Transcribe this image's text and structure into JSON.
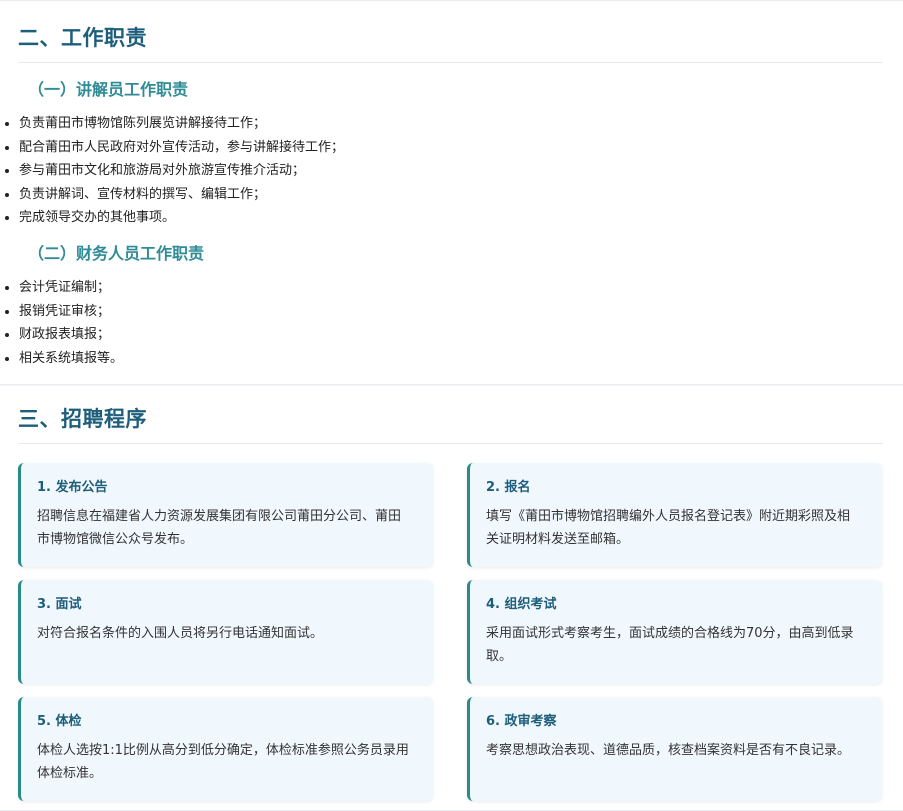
{
  "duties": {
    "title": "二、工作职责",
    "guide": {
      "title": "（一）讲解员工作职责",
      "items": [
        "负责莆田市博物馆陈列展览讲解接待工作；",
        "配合莆田市人民政府对外宣传活动，参与讲解接待工作；",
        "参与莆田市文化和旅游局对外旅游宣传推介活动；",
        "负责讲解词、宣传材料的撰写、编辑工作；",
        "完成领导交办的其他事项。"
      ]
    },
    "finance": {
      "title": "（二）财务人员工作职责",
      "items": [
        "会计凭证编制；",
        "报销凭证审核；",
        "财政报表填报；",
        "相关系统填报等。"
      ]
    }
  },
  "procedure": {
    "title": "三、招聘程序",
    "steps": [
      {
        "title": "1. 发布公告",
        "desc": "招聘信息在福建省人力资源发展集团有限公司莆田分公司、莆田市博物馆微信公众号发布。"
      },
      {
        "title": "2. 报名",
        "desc": "填写《莆田市博物馆招聘编外人员报名登记表》附近期彩照及相关证明材料发送至邮箱。"
      },
      {
        "title": "3. 面试",
        "desc": "对符合报名条件的入围人员将另行电话通知面试。"
      },
      {
        "title": "4. 组织考试",
        "desc": "采用面试形式考察考生，面试成绩的合格线为70分，由高到低录取。"
      },
      {
        "title": "5. 体检",
        "desc": "体检人选按1:1比例从高分到低分确定，体检标准参照公务员录用体检标准。"
      },
      {
        "title": "6. 政审考察",
        "desc": "考察思想政治表现、道德品质，核查档案资料是否有不良记录。"
      }
    ]
  },
  "colors": {
    "heading": "#1d5e7b",
    "subheading": "#2f8b96",
    "card_background": "#f0f7fd",
    "card_accent": "#2a8a88"
  }
}
